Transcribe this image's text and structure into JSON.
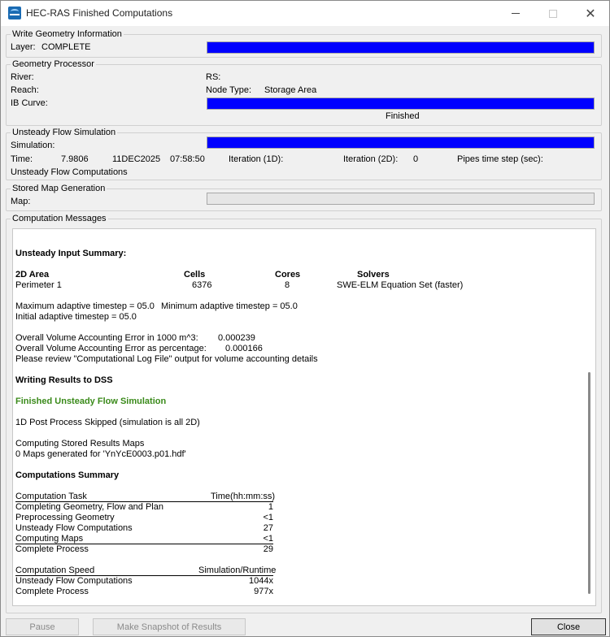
{
  "window": {
    "title": "HEC-RAS Finished Computations"
  },
  "write_geometry": {
    "title": "Write Geometry Information",
    "layer_label": "Layer:",
    "layer_value": "COMPLETE",
    "progress": 1.0
  },
  "geometry_processor": {
    "title": "Geometry Processor",
    "river_label": "River:",
    "rs_label": "RS:",
    "reach_label": "Reach:",
    "node_type_label": "Node Type:",
    "node_type_value": "Storage Area",
    "ib_curve_label": "IB Curve:",
    "progress": 1.0,
    "status": "Finished"
  },
  "unsteady_flow": {
    "title": "Unsteady Flow Simulation",
    "simulation_label": "Simulation:",
    "progress": 1.0,
    "time_label": "Time:",
    "time_value": "7.9806",
    "date_value": "11DEC2025",
    "clock_value": "07:58:50",
    "iteration_1d_label": "Iteration (1D):",
    "iteration_2d_label": "Iteration (2D):",
    "iteration_2d_value": "0",
    "pipes_label": "Pipes time step (sec):",
    "status": "Unsteady Flow Computations"
  },
  "stored_map": {
    "title": "Stored Map Generation",
    "map_label": "Map:",
    "progress": 0.0
  },
  "messages": {
    "title": "Computation Messages",
    "input_summary_heading": "Unsteady Input Summary:",
    "area_header": {
      "area": "2D Area",
      "cells": "Cells",
      "cores": "Cores",
      "solvers": "Solvers"
    },
    "area_row": {
      "area": "Perimeter 1",
      "cells": "6376",
      "cores": "8",
      "solvers": "SWE-ELM Equation Set (faster)"
    },
    "timestep_line_1a": "Maximum adaptive timestep = 05.0",
    "timestep_line_1b": "Minimum adaptive timestep = 05.0",
    "timestep_line_2": "Initial adaptive timestep = 05.0",
    "volume_error_label": "Overall Volume Accounting Error in 1000 m^3:",
    "volume_error_value": "0.000239",
    "volume_pct_label": "Overall Volume Accounting Error as percentage:",
    "volume_pct_value": "0.000166",
    "review_note": "Please review \"Computational Log File\" output for volume accounting details",
    "writing_results": "Writing Results to DSS",
    "finished_sim": "Finished Unsteady Flow Simulation",
    "post_process": "1D Post Process Skipped (simulation is all 2D)",
    "computing_maps": "Computing Stored Results Maps",
    "maps_generated": "0 Maps generated for 'YnYcE0003.p01.hdf'",
    "summary_heading": "Computations Summary",
    "task_table": {
      "header_task": "Computation Task",
      "header_time": "Time(hh:mm:ss)",
      "rows": [
        {
          "task": "Completing Geometry, Flow and Plan",
          "time": "1"
        },
        {
          "task": "Preprocessing Geometry",
          "time": "<1"
        },
        {
          "task": "Unsteady Flow Computations",
          "time": "27"
        },
        {
          "task": "Computing Maps",
          "time": "<1"
        },
        {
          "task": "Complete Process",
          "time": "29"
        }
      ]
    },
    "speed_table": {
      "header_task": "Computation Speed",
      "header_value": "Simulation/Runtime",
      "rows": [
        {
          "task": "Unsteady Flow Computations",
          "value": "1044x"
        },
        {
          "task": "Complete Process",
          "value": "977x"
        }
      ]
    }
  },
  "buttons": {
    "pause": "Pause",
    "snapshot": "Make Snapshot of Results",
    "close": "Close"
  },
  "colors": {
    "progress_fill": "#0000ff",
    "finished_text": "#3a8a1a"
  }
}
